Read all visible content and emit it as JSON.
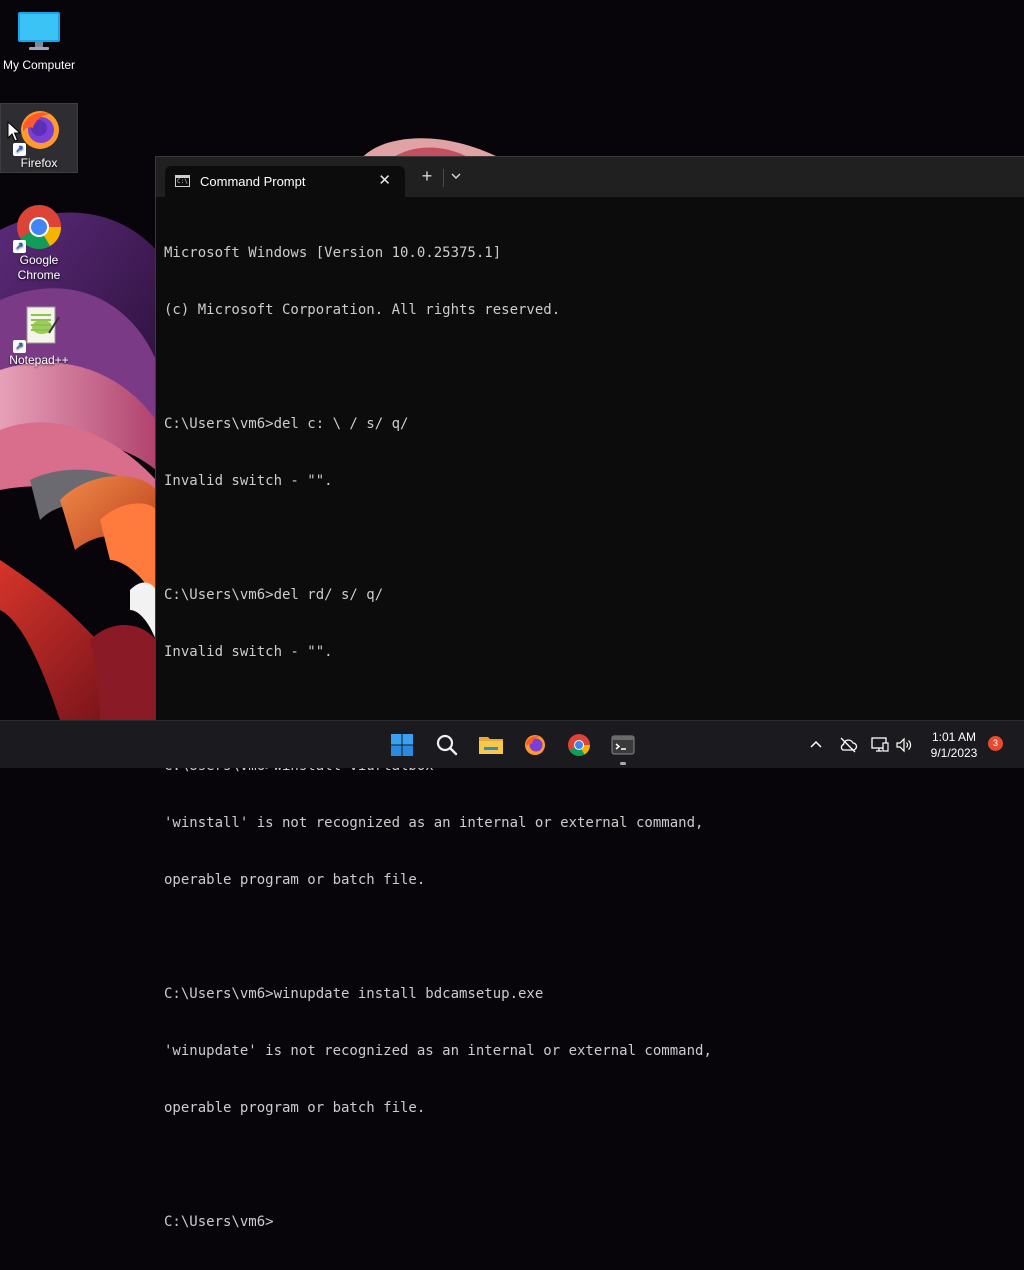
{
  "desktop": {
    "icons": [
      {
        "label": "My Computer"
      },
      {
        "label": "Firefox"
      },
      {
        "label": "Google Chrome"
      },
      {
        "label": "Notepad++"
      }
    ]
  },
  "terminal": {
    "tab_title": "Command Prompt",
    "tab_close": "✕",
    "new_tab": "+",
    "lines": [
      "Microsoft Windows [Version 10.0.25375.1]",
      "(c) Microsoft Corporation. All rights reserved.",
      "",
      "C:\\Users\\vm6>del c: \\ / s/ q/",
      "Invalid switch - \"\".",
      "",
      "C:\\Users\\vm6>del rd/ s/ q/",
      "Invalid switch - \"\".",
      "",
      "C:\\Users\\vm6>winstall viurtalbox",
      "'winstall' is not recognized as an internal or external command,",
      "operable program or batch file.",
      "",
      "C:\\Users\\vm6>winupdate install bdcamsetup.exe",
      "'winupdate' is not recognized as an internal or external command,",
      "operable program or batch file.",
      "",
      "C:\\Users\\vm6>"
    ]
  },
  "taskbar": {
    "pinned": [
      {
        "name": "start",
        "icon": "windows-logo-icon"
      },
      {
        "name": "search",
        "icon": "search-icon"
      },
      {
        "name": "file-explorer",
        "icon": "folder-icon"
      },
      {
        "name": "firefox",
        "icon": "firefox-icon"
      },
      {
        "name": "chrome",
        "icon": "chrome-icon"
      },
      {
        "name": "terminal",
        "icon": "terminal-icon",
        "active": true
      }
    ],
    "tray": {
      "time": "1:01 AM",
      "date": "9/1/2023",
      "notification_count": "3"
    }
  },
  "colors": {
    "console_bg": "#0c0c0c",
    "console_fg": "#cccccc",
    "tabbar_bg": "#202020",
    "taskbar_bg": "#1b1b1f",
    "badge": "#e64b2f"
  }
}
